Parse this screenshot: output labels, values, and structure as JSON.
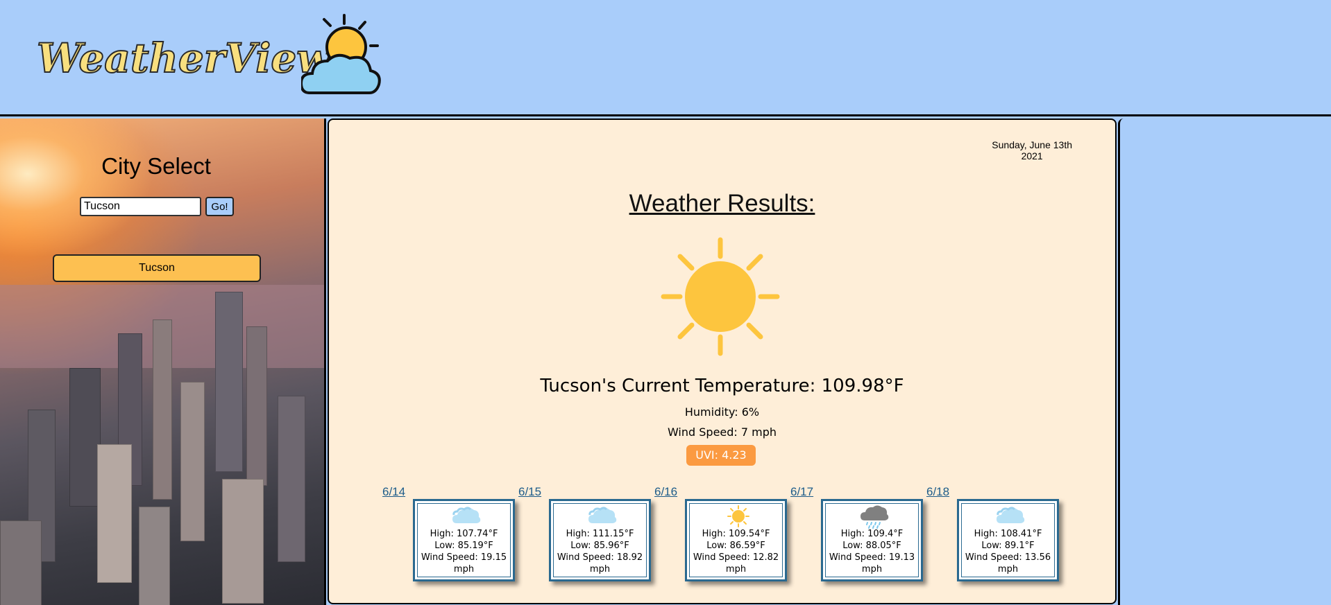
{
  "header": {
    "logo_text": "WeatherView"
  },
  "sidebar": {
    "title": "City Select",
    "search_value": "Tucson",
    "go_label": "Go!",
    "history": [
      "Tucson"
    ]
  },
  "main": {
    "date_line1": "Sunday, June 13th",
    "date_line2": "2021",
    "results_title": "Weather Results:",
    "current_icon": "sun-icon",
    "temperature": "Tucson's Current Temperature: 109.98°F",
    "humidity": "Humidity: 6%",
    "wind": "Wind Speed: 7 mph",
    "uvi": "UVI: 4.23",
    "uvi_color": "#fb9a41"
  },
  "forecast": [
    {
      "date": "6/14",
      "icon": "cloud-icon",
      "high": "High: 107.74°F",
      "low": "Low: 85.19°F",
      "wind": "Wind Speed: 19.15",
      "unit": "mph"
    },
    {
      "date": "6/15",
      "icon": "cloud-icon",
      "high": "High: 111.15°F",
      "low": "Low: 85.96°F",
      "wind": "Wind Speed: 18.92",
      "unit": "mph"
    },
    {
      "date": "6/16",
      "icon": "sun-icon",
      "high": "High: 109.54°F",
      "low": "Low: 86.59°F",
      "wind": "Wind Speed: 12.82",
      "unit": "mph"
    },
    {
      "date": "6/17",
      "icon": "rain-cloud-icon",
      "high": "High: 109.4°F",
      "low": "Low: 88.05°F",
      "wind": "Wind Speed: 19.13",
      "unit": "mph"
    },
    {
      "date": "6/18",
      "icon": "cloud-icon",
      "high": "High: 108.41°F",
      "low": "Low: 89.1°F",
      "wind": "Wind Speed: 13.56",
      "unit": "mph"
    }
  ],
  "colors": {
    "page_bg": "#a9cdfa",
    "panel_bg": "#feeed8",
    "history_button": "#fdc051",
    "card_border": "#2a6990"
  }
}
